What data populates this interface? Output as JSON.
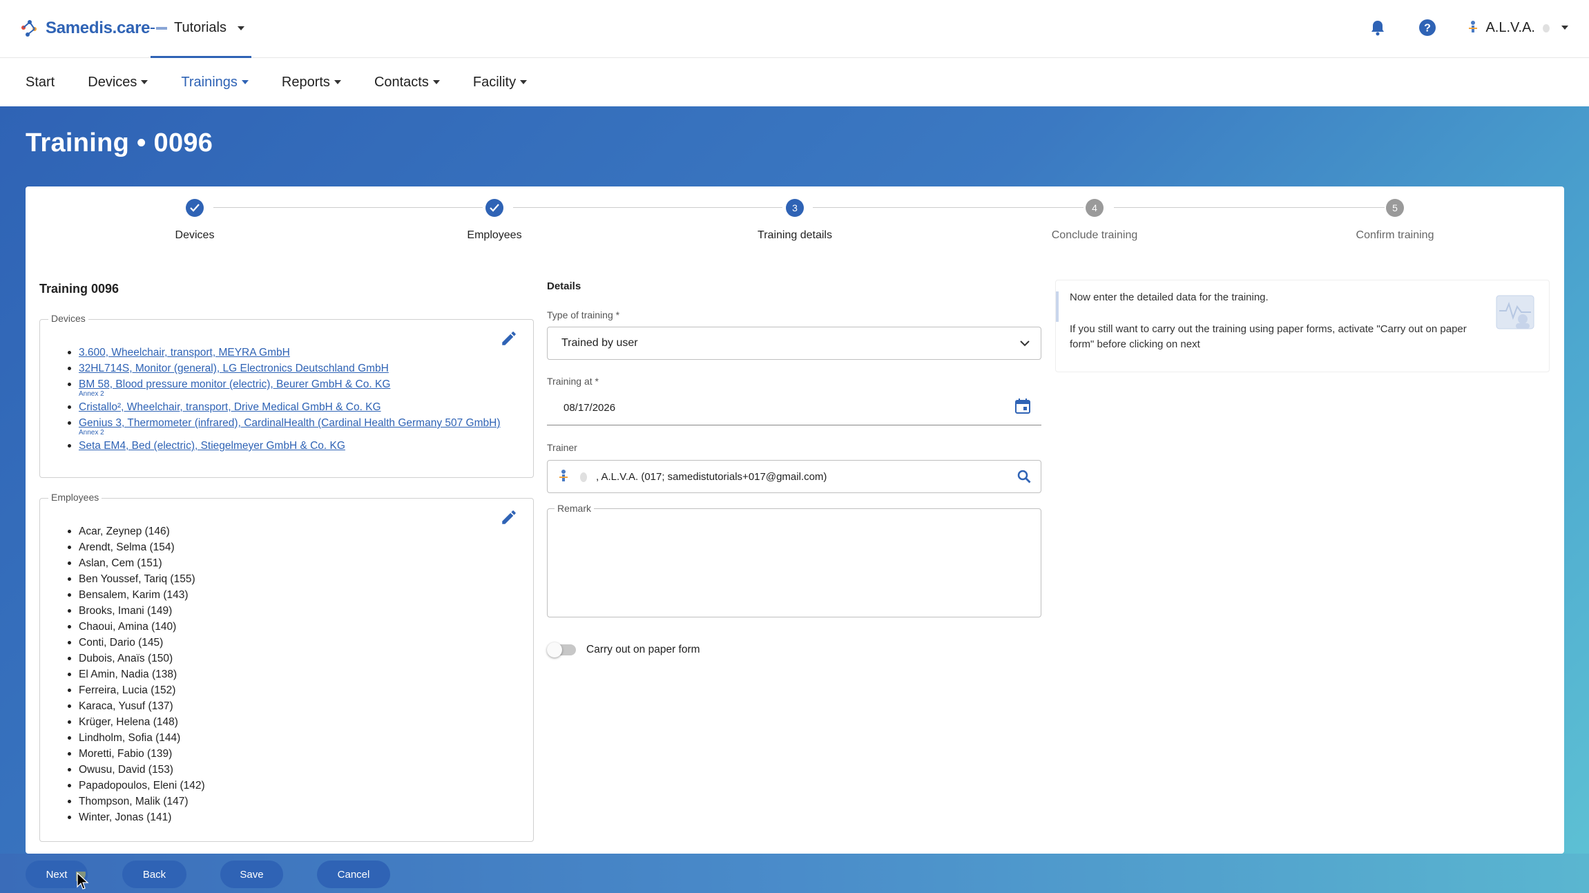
{
  "app": {
    "brand": "Samedis.care",
    "tenant": "Tutorials",
    "user": "A.L.V.A."
  },
  "nav": {
    "items": [
      {
        "label": "Start"
      },
      {
        "label": "Devices"
      },
      {
        "label": "Trainings",
        "active": true
      },
      {
        "label": "Reports"
      },
      {
        "label": "Contacts"
      },
      {
        "label": "Facility"
      }
    ]
  },
  "page": {
    "title": "Training • 0096"
  },
  "stepper": {
    "steps": [
      {
        "label": "Devices",
        "number": "1",
        "state": "done"
      },
      {
        "label": "Employees",
        "number": "2",
        "state": "done"
      },
      {
        "label": "Training details",
        "number": "3",
        "state": "active"
      },
      {
        "label": "Conclude training",
        "number": "4",
        "state": "pending"
      },
      {
        "label": "Confirm training",
        "number": "5",
        "state": "pending"
      }
    ]
  },
  "summary": {
    "title": "Training 0096",
    "devices_legend": "Devices",
    "devices": [
      {
        "label": "3.600, Wheelchair, transport, MEYRA GmbH",
        "annex": ""
      },
      {
        "label": "32HL714S, Monitor (general), LG Electronics Deutschland GmbH",
        "annex": ""
      },
      {
        "label": "BM 58, Blood pressure monitor (electric), Beurer GmbH & Co. KG",
        "annex": "Annex 2"
      },
      {
        "label": "Cristallo², Wheelchair, transport, Drive Medical GmbH & Co. KG",
        "annex": ""
      },
      {
        "label": "Genius 3, Thermometer (infrared), CardinalHealth (Cardinal Health Germany 507 GmbH)",
        "annex": "Annex 2"
      },
      {
        "label": "Seta EM4, Bed (electric), Stiegelmeyer GmbH & Co. KG",
        "annex": ""
      }
    ],
    "employees_legend": "Employees",
    "employees": [
      "Acar, Zeynep (146)",
      "Arendt, Selma (154)",
      "Aslan, Cem (151)",
      "Ben Youssef, Tariq (155)",
      "Bensalem, Karim (143)",
      "Brooks, Imani (149)",
      "Chaoui, Amina (140)",
      "Conti, Dario (145)",
      "Dubois, Anaïs (150)",
      "El Amin, Nadia (138)",
      "Ferreira, Lucia (152)",
      "Karaca, Yusuf (137)",
      "Krüger, Helena (148)",
      "Lindholm, Sofia (144)",
      "Moretti, Fabio (139)",
      "Owusu, David (153)",
      "Papadopoulos, Eleni (142)",
      "Thompson, Malik (147)",
      "Winter, Jonas (141)"
    ]
  },
  "details": {
    "title": "Details",
    "type_label": "Type of training *",
    "type_value": "Trained by user",
    "date_label": "Training at *",
    "date_value": "08/17/2026",
    "trainer_label": "Trainer",
    "trainer_value": ", A.L.V.A. (017; samedistutorials+017@gmail.com)",
    "remark_label": "Remark",
    "paper_toggle_label": "Carry out on paper form"
  },
  "info": {
    "line1": "Now enter the detailed data for the training.",
    "line2": "If you still want to carry out the training using paper forms, activate \"Carry out on paper form\" before clicking on next"
  },
  "actions": {
    "next": "Next",
    "back": "Back",
    "save": "Save",
    "cancel": "Cancel"
  },
  "colors": {
    "primary": "#2f63b5",
    "toggle_off": "#c7c7c7"
  }
}
